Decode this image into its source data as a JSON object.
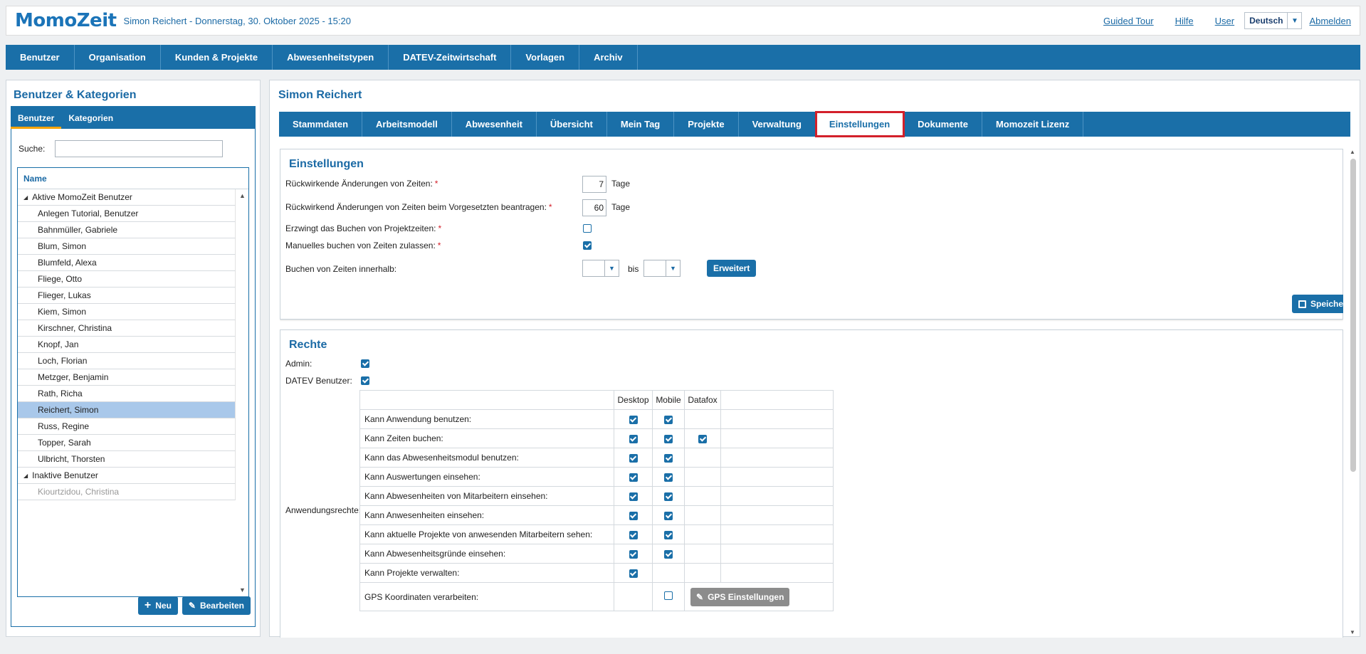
{
  "header": {
    "logo_a": "Momo",
    "logo_b": "Zeit",
    "subtitle": "Simon Reichert - Donnerstag, 30. Oktober 2025 - 15:20",
    "links": {
      "tour": "Guided Tour",
      "hilfe": "Hilfe",
      "user": "User",
      "abmelden": "Abmelden"
    },
    "language": "Deutsch"
  },
  "mainnav": [
    "Benutzer",
    "Organisation",
    "Kunden & Projekte",
    "Abwesenheitstypen",
    "DATEV-Zeitwirtschaft",
    "Vorlagen",
    "Archiv"
  ],
  "left": {
    "title": "Benutzer & Kategorien",
    "tabs": [
      "Benutzer",
      "Kategorien"
    ],
    "search_label": "Suche:",
    "search_value": "",
    "column": "Name",
    "group_active": "Aktive MomoZeit Benutzer",
    "users": [
      "Anlegen Tutorial, Benutzer",
      "Bahnmüller, Gabriele",
      "Blum, Simon",
      "Blumfeld, Alexa",
      "Fliege, Otto",
      "Flieger, Lukas",
      "Kiem, Simon",
      "Kirschner, Christina",
      "Knopf, Jan",
      "Loch, Florian",
      "Metzger, Benjamin",
      "Rath, Richa",
      "Reichert, Simon",
      "Russ, Regine",
      "Topper, Sarah",
      "Ulbricht, Thorsten"
    ],
    "selected_user": "Reichert, Simon",
    "group_inactive": "Inaktive Benutzer",
    "inactive_users": [
      "Kiourtzidou, Christina"
    ],
    "btn_new": "Neu",
    "btn_edit": "Bearbeiten"
  },
  "right": {
    "title": "Simon Reichert",
    "tabs": [
      "Stammdaten",
      "Arbeitsmodell",
      "Abwesenheit",
      "Übersicht",
      "Mein Tag",
      "Projekte",
      "Verwaltung",
      "Einstellungen",
      "Dokumente",
      "Momozeit Lizenz"
    ],
    "active_tab": "Einstellungen",
    "settings": {
      "title": "Einstellungen",
      "retro_label": "Rückwirkende Änderungen von Zeiten:",
      "retro_value": "7",
      "retro_unit": "Tage",
      "retro_sup_label": "Rückwirkend Änderungen von Zeiten beim Vorgesetzten beantragen:",
      "retro_sup_value": "60",
      "retro_sup_unit": "Tage",
      "force_project_label": "Erzwingt das Buchen von Projektzeiten:",
      "force_project": false,
      "manual_label": "Manuelles buchen von Zeiten zulassen:",
      "manual": true,
      "within_label": "Buchen von Zeiten innerhalb:",
      "within_from": "",
      "within_bis": "bis",
      "within_to": "",
      "btn_extended": "Erweitert",
      "btn_save": "Speichern",
      "required_mark": "*"
    },
    "rights": {
      "title": "Rechte",
      "admin_label": "Admin:",
      "admin": true,
      "datev_label": "DATEV Benutzer:",
      "datev": true,
      "app_rights_label": "Anwendungsrechte:",
      "columns": [
        "Desktop",
        "Mobile",
        "Datafox"
      ],
      "rows": [
        {
          "label": "Kann Anwendung benutzen:",
          "desktop": true,
          "mobile": true,
          "datafox": null
        },
        {
          "label": "Kann Zeiten buchen:",
          "desktop": true,
          "mobile": true,
          "datafox": true
        },
        {
          "label": "Kann das Abwesenheitsmodul benutzen:",
          "desktop": true,
          "mobile": true,
          "datafox": null
        },
        {
          "label": "Kann Auswertungen einsehen:",
          "desktop": true,
          "mobile": true,
          "datafox": null
        },
        {
          "label": "Kann Abwesenheiten von Mitarbeitern einsehen:",
          "desktop": true,
          "mobile": true,
          "datafox": null
        },
        {
          "label": "Kann Anwesenheiten einsehen:",
          "desktop": true,
          "mobile": true,
          "datafox": null
        },
        {
          "label": "Kann aktuelle Projekte von anwesenden Mitarbeitern sehen:",
          "desktop": true,
          "mobile": true,
          "datafox": null
        },
        {
          "label": "Kann Abwesenheitsgründe einsehen:",
          "desktop": true,
          "mobile": true,
          "datafox": null
        },
        {
          "label": "Kann Projekte verwalten:",
          "desktop": true,
          "mobile": null,
          "datafox": null
        },
        {
          "label": "GPS Koordinaten verarbeiten:",
          "desktop": null,
          "mobile": false,
          "datafox": null
        }
      ],
      "btn_gps": "GPS Einstellungen"
    }
  },
  "colors": {
    "primary": "#1a6fa8",
    "highlight": "#d3202a",
    "selected_row": "#a9c8ea",
    "required": "#d3202a"
  }
}
